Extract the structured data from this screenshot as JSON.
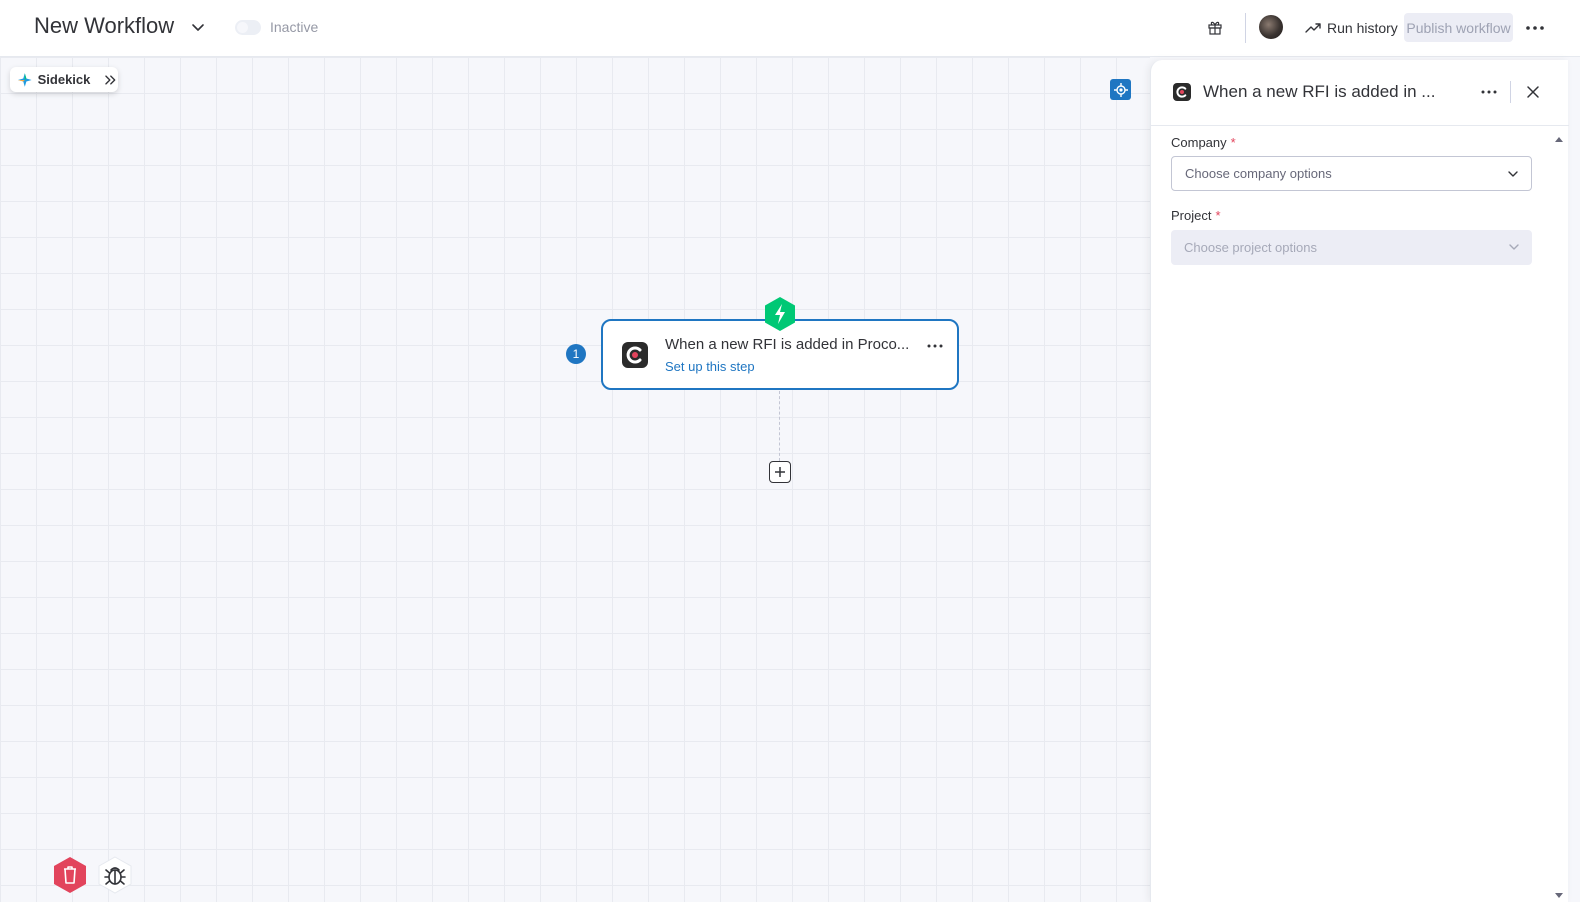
{
  "header": {
    "workflow_title": "New Workflow",
    "status_label": "Inactive",
    "run_history_label": "Run history",
    "publish_label": "Publish workflow"
  },
  "canvas": {
    "sidekick_label": "Sidekick",
    "step": {
      "number": "1",
      "title": "When a new RFI is added in Proco...",
      "subtitle": "Set up this step"
    }
  },
  "panel": {
    "title": "When a new RFI is added in ...",
    "fields": [
      {
        "label": "Company",
        "required_mark": "*",
        "placeholder": "Choose company options",
        "enabled": true
      },
      {
        "label": "Project",
        "required_mark": "*",
        "placeholder": "Choose project options",
        "enabled": false
      }
    ]
  },
  "colors": {
    "accent": "#1f76c2",
    "trigger_green": "#00c875",
    "danger_red": "#e2445c",
    "brand_dark": "#2b2b2b"
  },
  "icons": [
    "chevron-down-icon",
    "gift-icon",
    "trend-icon",
    "more-horizontal-icon",
    "sparkle-icon",
    "double-chevron-right-icon",
    "locate-icon",
    "lightning-icon",
    "plus-icon",
    "trash-icon",
    "bug-icon",
    "close-icon"
  ]
}
